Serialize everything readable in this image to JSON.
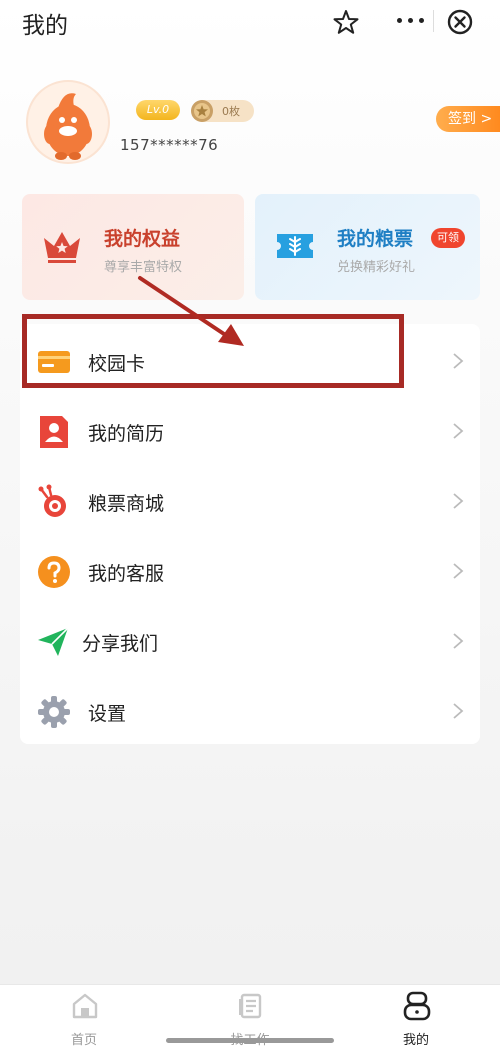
{
  "header": {
    "title": "我的"
  },
  "profile": {
    "level": "Lv.0",
    "coins": "0枚",
    "phone": "157******76",
    "sign_in": "签到 >"
  },
  "cards": {
    "rights": {
      "title": "我的权益",
      "subtitle": "尊享丰富特权",
      "color": "#c9412d"
    },
    "tickets": {
      "title": "我的粮票",
      "subtitle": "兑换精彩好礼",
      "badge": "可领",
      "color": "#1f7fc4"
    }
  },
  "menu": {
    "items": [
      {
        "label": "校园卡",
        "icon": "campus-card-icon"
      },
      {
        "label": "我的简历",
        "icon": "resume-icon"
      },
      {
        "label": "粮票商城",
        "icon": "mall-icon"
      },
      {
        "label": "我的客服",
        "icon": "help-icon"
      },
      {
        "label": "分享我们",
        "icon": "share-icon"
      },
      {
        "label": "设置",
        "icon": "settings-icon"
      }
    ]
  },
  "tabs": [
    {
      "label": "首页",
      "icon": "home-icon",
      "active": false
    },
    {
      "label": "找工作",
      "icon": "jobs-icon",
      "active": false
    },
    {
      "label": "我的",
      "icon": "profile-icon",
      "active": true
    }
  ],
  "colors": {
    "accent": "#ff8a1f",
    "annotation": "#a72a25"
  }
}
